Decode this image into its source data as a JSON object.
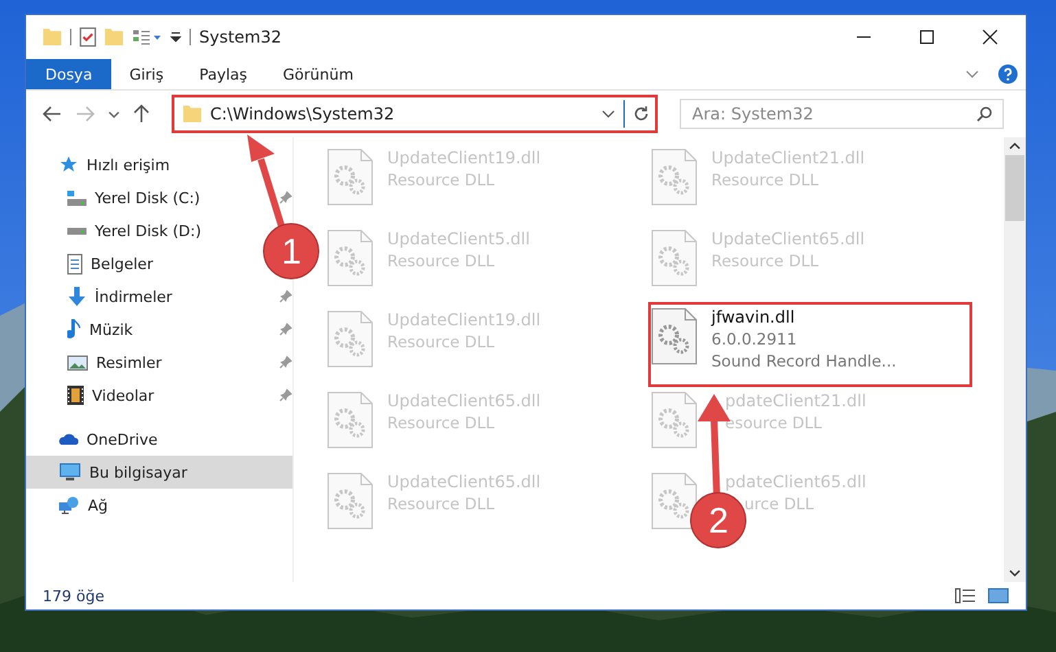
{
  "window": {
    "title": "System32"
  },
  "ribbon": {
    "tabs": [
      {
        "label": "Dosya",
        "selected": true
      },
      {
        "label": "Giriş",
        "selected": false
      },
      {
        "label": "Paylaş",
        "selected": false
      },
      {
        "label": "Görünüm",
        "selected": false
      }
    ]
  },
  "address": {
    "path": "C:\\Windows\\System32",
    "highlighted": true,
    "search_placeholder": "Ara: System32"
  },
  "sidebar": {
    "items": [
      {
        "label": "Hızlı erişim",
        "kind": "quick",
        "selected": false,
        "children": [
          {
            "label": "Yerel Disk (C:)",
            "kind": "drive-c",
            "pinned": true
          },
          {
            "label": "Yerel Disk (D:)",
            "kind": "drive",
            "pinned": false
          },
          {
            "label": "Belgeler",
            "kind": "docs",
            "pinned": false
          },
          {
            "label": "İndirmeler",
            "kind": "download",
            "pinned": true
          },
          {
            "label": "Müzik",
            "kind": "music",
            "pinned": true
          },
          {
            "label": "Resimler",
            "kind": "pictures",
            "pinned": true
          },
          {
            "label": "Videolar",
            "kind": "videos",
            "pinned": true
          }
        ]
      },
      {
        "label": "OneDrive",
        "kind": "cloud",
        "selected": false
      },
      {
        "label": "Bu bilgisayar",
        "kind": "pc",
        "selected": true
      },
      {
        "label": "Ağ",
        "kind": "network",
        "selected": false
      }
    ]
  },
  "files": [
    {
      "name": "UpdateClient19.dll",
      "details": [
        "Resource DLL"
      ],
      "blurred": true,
      "highlighted": false,
      "kind": "plain"
    },
    {
      "name": "UpdateClient21.dll",
      "details": [
        "Resource DLL"
      ],
      "blurred": true,
      "highlighted": false,
      "kind": "plain"
    },
    {
      "name": "UpdateClient5.dll",
      "details": [
        "Resource DLL"
      ],
      "blurred": true,
      "highlighted": false,
      "kind": "plain"
    },
    {
      "name": "UpdateClient65.dll",
      "details": [
        "Resource DLL"
      ],
      "blurred": true,
      "highlighted": false,
      "kind": "plain"
    },
    {
      "name": "UpdateClient19.dll",
      "details": [
        "Resource DLL"
      ],
      "blurred": true,
      "highlighted": false,
      "kind": "plain"
    },
    {
      "name": "jfwavin.dll",
      "details": [
        "6.0.0.2911",
        "Sound Record Handle..."
      ],
      "blurred": false,
      "highlighted": true,
      "kind": "plain"
    },
    {
      "name": "UpdateClient65.dll",
      "details": [
        "Resource DLL"
      ],
      "blurred": true,
      "highlighted": false,
      "kind": "plain"
    },
    {
      "name": "pdateClient21.dll",
      "details": [
        "esource DLL"
      ],
      "blurred": true,
      "highlighted": false,
      "kind": "under-arrow"
    },
    {
      "name": "UpdateClient65.dll",
      "details": [
        "Resource DLL"
      ],
      "blurred": true,
      "highlighted": false,
      "kind": "plain"
    },
    {
      "name": "pdateClient65.dll",
      "details": [
        "urce DLL"
      ],
      "blurred": true,
      "highlighted": false,
      "kind": "under-marker"
    }
  ],
  "annotations": [
    {
      "label": "1"
    },
    {
      "label": "2"
    }
  ],
  "status_bar": {
    "count": "179 öğe"
  }
}
